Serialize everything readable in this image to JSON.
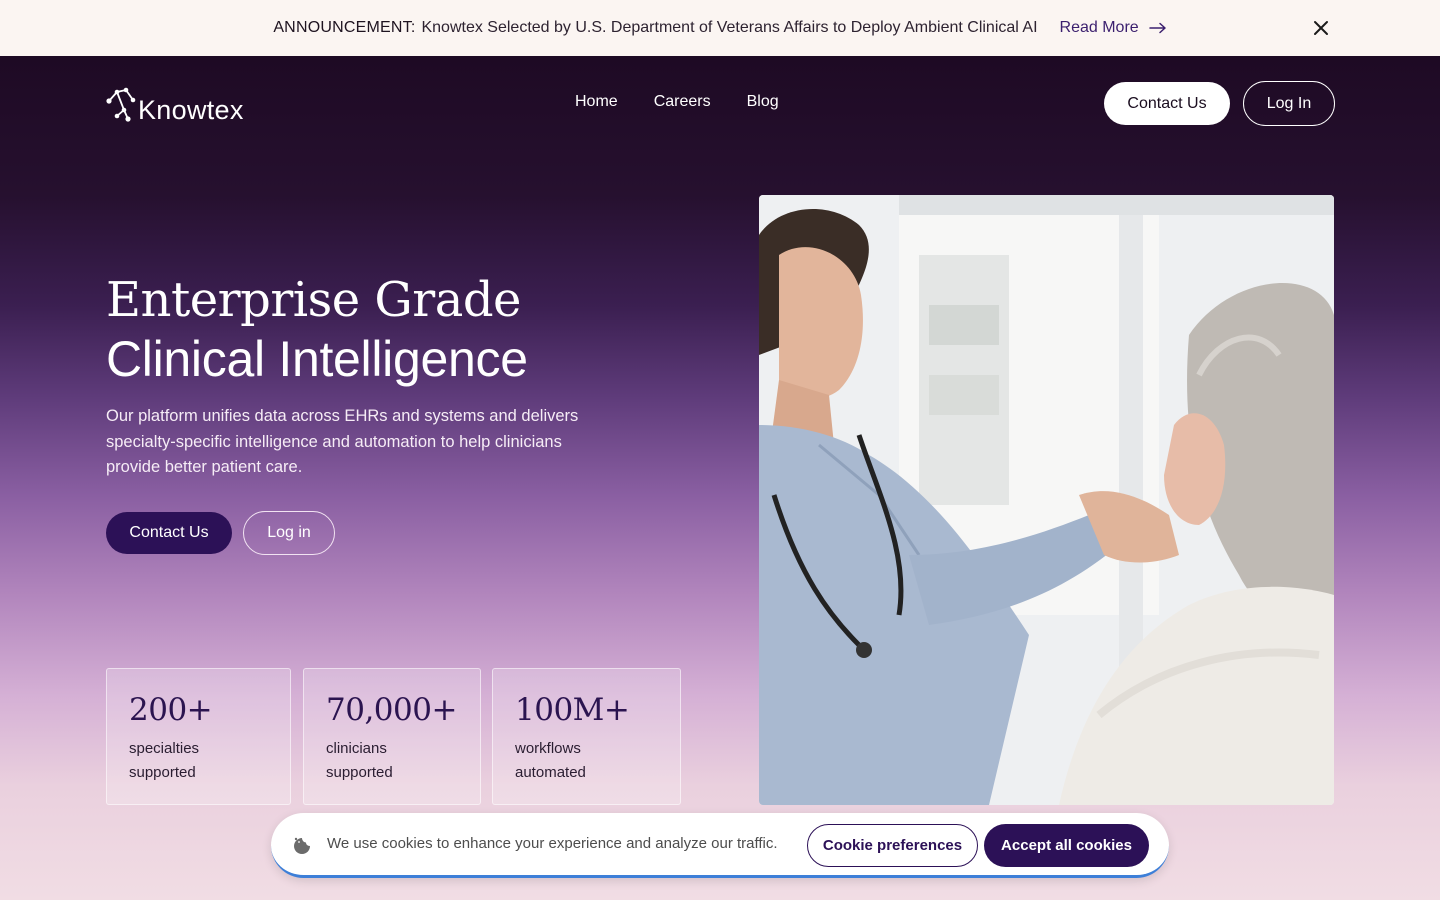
{
  "announcement": {
    "label": "ANNOUNCEMENT:",
    "text": "Knowtex Selected by U.S. Department of Veterans Affairs to Deploy Ambient Clinical AI",
    "link_label": "Read More"
  },
  "header": {
    "logo_text": "Knowtex",
    "nav": [
      {
        "label": "Home"
      },
      {
        "label": "Careers"
      },
      {
        "label": "Blog"
      }
    ],
    "contact_label": "Contact Us",
    "login_label": "Log In"
  },
  "hero": {
    "title_line1": "Enterprise Grade",
    "title_line2": "Clinical Intelligence",
    "description": "Our platform unifies data across EHRs and systems and delivers specialty-specific intelligence and automation to help clinicians provide better patient care.",
    "contact_label": "Contact Us",
    "login_label": "Log in"
  },
  "stats": [
    {
      "value": "200+",
      "label": "specialties supported"
    },
    {
      "value": "70,000+",
      "label": "clinicians supported"
    },
    {
      "value": "100M+",
      "label": "workflows automated"
    }
  ],
  "cookie": {
    "text": "We use cookies to enhance your experience and analyze our traffic.",
    "preferences_label": "Cookie preferences",
    "accept_label": "Accept all cookies"
  },
  "colors": {
    "brand_dark": "#2c1157",
    "announcement_bg": "#fbf5f2",
    "cookie_accent": "#3d7fd8"
  }
}
